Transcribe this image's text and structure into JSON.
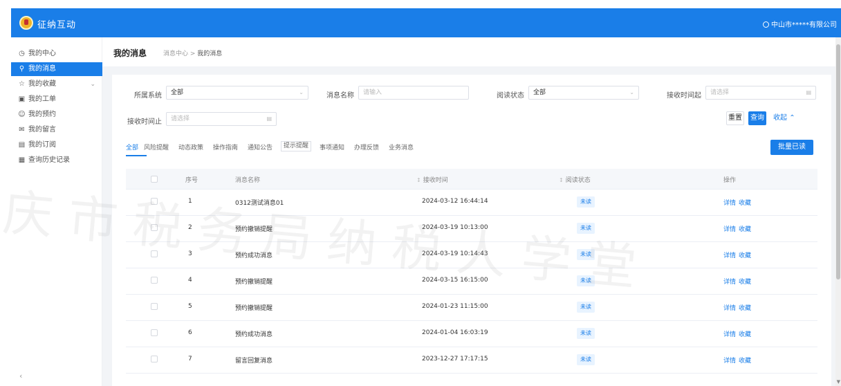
{
  "app": {
    "title": "征纳互动",
    "user": "中山市*****有限公司"
  },
  "sidebar": {
    "items": [
      {
        "label": "我的中心",
        "icon": "clock-icon"
      },
      {
        "label": "我的消息",
        "icon": "pin-icon"
      },
      {
        "label": "我的收藏",
        "icon": "star-icon"
      },
      {
        "label": "我的工单",
        "icon": "document-icon"
      },
      {
        "label": "我的预约",
        "icon": "user-icon"
      },
      {
        "label": "我的留言",
        "icon": "mail-icon"
      },
      {
        "label": "我的订阅",
        "icon": "calendar-icon"
      },
      {
        "label": "查询历史记录",
        "icon": "record-icon"
      }
    ]
  },
  "page": {
    "title": "我的消息",
    "crumb_parent": "消息中心",
    "crumb_current": "我的消息"
  },
  "filters": {
    "system": {
      "label": "所属系统",
      "value": "全部"
    },
    "name": {
      "label": "消息名称",
      "placeholder": "请输入"
    },
    "status": {
      "label": "阅读状态",
      "value": "全部"
    },
    "start": {
      "label": "接收时间起",
      "placeholder": "请选择"
    },
    "end": {
      "label": "接收时间止",
      "placeholder": "请选择"
    }
  },
  "buttons": {
    "reset": "重置",
    "search": "查询",
    "collapse": "收起",
    "read_all": "批量已读"
  },
  "tabs": [
    "全部",
    "风险提醒",
    "动态政策",
    "操作指南",
    "通知公告",
    "提示提醒",
    "事项通知",
    "办理反馈",
    "业务消息"
  ],
  "table": {
    "headers": [
      "序号",
      "消息名称",
      "接收时间",
      "阅读状态",
      "操作"
    ],
    "rows": [
      {
        "no": "1",
        "name": "0312测试消息01",
        "time": "2024-03-12 16:44:14",
        "status": "未读"
      },
      {
        "no": "2",
        "name": "预约撤销提醒",
        "time": "2024-03-19 10:13:00",
        "status": "未读"
      },
      {
        "no": "3",
        "name": "预约成功消息",
        "time": "2024-03-19 10:14:43",
        "status": "未读"
      },
      {
        "no": "4",
        "name": "预约撤销提醒",
        "time": "2024-03-15 16:15:00",
        "status": "未读"
      },
      {
        "no": "5",
        "name": "预约撤销提醒",
        "time": "2024-01-23 11:15:00",
        "status": "未读"
      },
      {
        "no": "6",
        "name": "预约成功消息",
        "time": "2024-01-04 16:03:19",
        "status": "未读"
      },
      {
        "no": "7",
        "name": "留言回复消息",
        "time": "2023-12-27 17:17:15",
        "status": "未读"
      }
    ],
    "ops": {
      "detail": "详情",
      "collect": "收藏"
    }
  },
  "watermark": "庆市税务局纳税人学堂"
}
